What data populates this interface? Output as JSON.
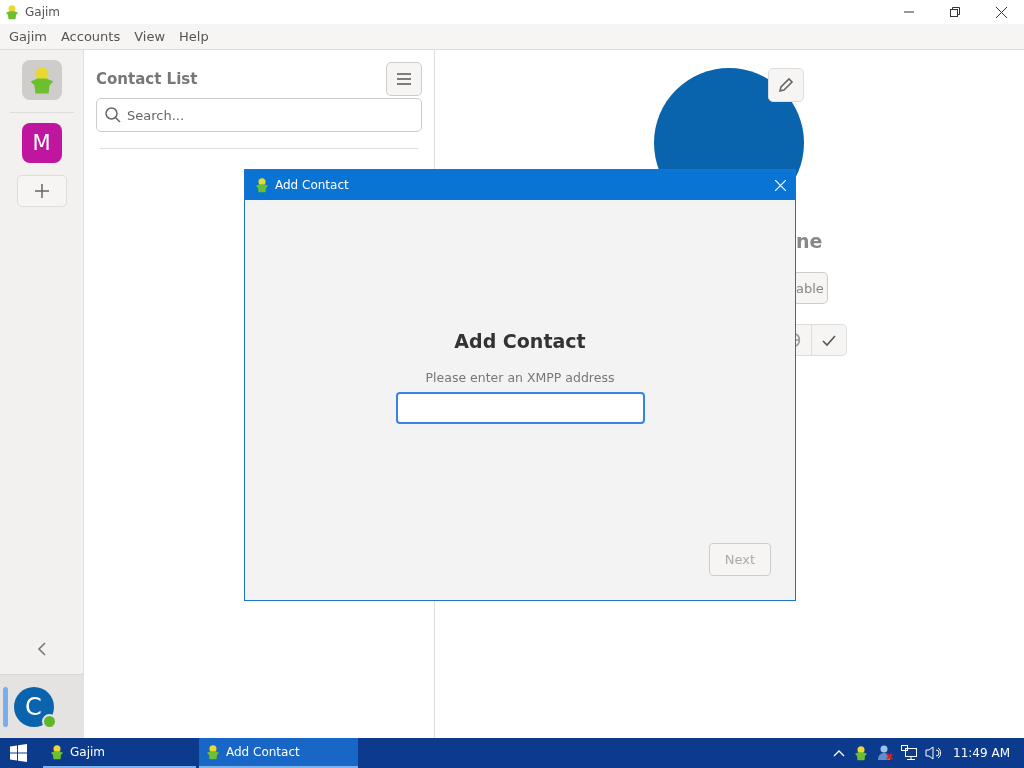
{
  "window": {
    "title": "Gajim"
  },
  "menu": [
    "Gajim",
    "Accounts",
    "View",
    "Help"
  ],
  "accounts_rail": {
    "items": [
      {
        "kind": "logo",
        "selected": true
      },
      {
        "kind": "letter",
        "label": "M",
        "color": "#c0169f",
        "selected": false
      }
    ],
    "account": {
      "letter": "C",
      "online": true,
      "selected": true
    }
  },
  "contact_list": {
    "title": "Contact List",
    "search": {
      "placeholder": "Search..."
    }
  },
  "contact_profile": {
    "name_fragment": "ne",
    "button_fragment": "able"
  },
  "dialog": {
    "title": "Add Contact",
    "heading": "Add Contact",
    "prompt": "Please enter an XMPP address",
    "address": {
      "focused": true
    },
    "next": {
      "label": "Next",
      "disabled": true
    }
  },
  "taskbar": {
    "apps": [
      {
        "label": "Gajim",
        "selected": false
      },
      {
        "label": "Add Contact",
        "selected": true
      }
    ],
    "clock": "11:49 AM"
  }
}
